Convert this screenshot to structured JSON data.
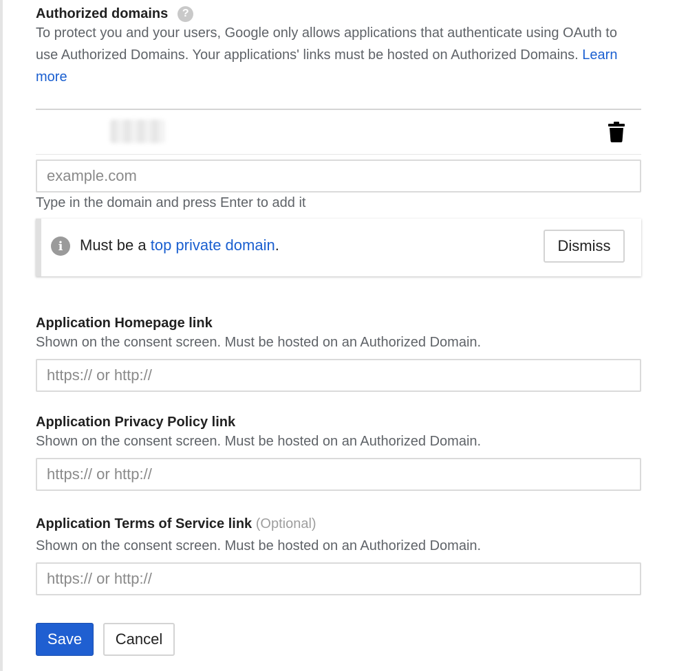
{
  "authorized_domains": {
    "title": "Authorized domains",
    "help_icon": "help-circle-icon",
    "description": "To protect you and your users, Google only allows applications that authenticate using OAuth to use Authorized Domains. Your applications' links must be hosted on Authorized Domains.",
    "learn_more": "Learn more",
    "delete_icon": "trash-icon",
    "input_placeholder": "example.com",
    "hint": "Type in the domain and press Enter to add it"
  },
  "notice": {
    "icon": "info-icon",
    "prefix": "Must be a ",
    "link": "top private domain",
    "suffix": ".",
    "dismiss_label": "Dismiss"
  },
  "homepage": {
    "title": "Application Homepage link",
    "description": "Shown on the consent screen. Must be hosted on an Authorized Domain.",
    "placeholder": "https:// or http://"
  },
  "privacy": {
    "title": "Application Privacy Policy link",
    "description": "Shown on the consent screen. Must be hosted on an Authorized Domain.",
    "placeholder": "https:// or http://"
  },
  "terms": {
    "title": "Application Terms of Service link",
    "optional": "(Optional)",
    "description": "Shown on the consent screen. Must be hosted on an Authorized Domain.",
    "placeholder": "https:// or http://"
  },
  "actions": {
    "save_label": "Save",
    "cancel_label": "Cancel"
  },
  "colors": {
    "link": "#1a5fd0",
    "primary_button": "#1f5fd1"
  }
}
